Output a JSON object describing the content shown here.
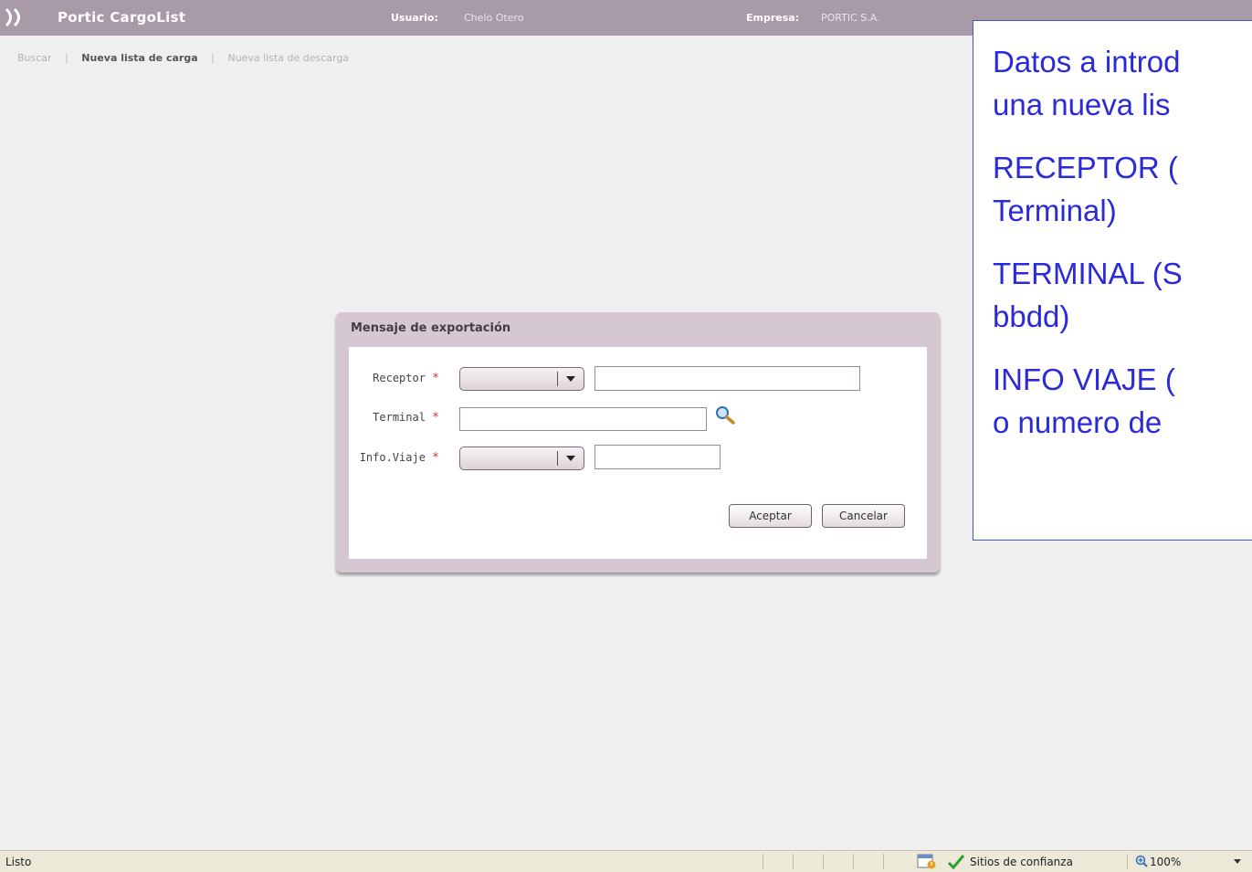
{
  "header": {
    "app_title": "Portic CargoList",
    "user_label": "Usuario:",
    "user_value": "Chelo Otero",
    "company_label": "Empresa:",
    "company_value": "PORTIC S.A."
  },
  "nav": {
    "items": [
      {
        "label": "Buscar",
        "active": false
      },
      {
        "label": "Nueva lista de carga",
        "active": true
      },
      {
        "label": "Nueva lista de descarga",
        "active": false
      }
    ],
    "separator": "|"
  },
  "dialog": {
    "title": "Mensaje de exportación",
    "fields": {
      "receptor": {
        "label": "Receptor",
        "required_mark": "*",
        "select_value": "",
        "text_value": ""
      },
      "terminal": {
        "label": "Terminal",
        "required_mark": "*",
        "text_value": ""
      },
      "info_viaje": {
        "label": "Info.Viaje",
        "required_mark": "*",
        "select_value": "",
        "text_value": ""
      }
    },
    "buttons": {
      "accept": "Aceptar",
      "cancel": "Cancelar"
    }
  },
  "callout": {
    "lines": [
      "Datos a introd",
      "una nueva lis",
      "RECEPTOR (",
      "Terminal)",
      "TERMINAL (S",
      "bbdd)",
      "INFO VIAJE (",
      "o numero de"
    ]
  },
  "statusbar": {
    "status": "Listo",
    "zone": "Sitios de confianza",
    "zoom": "100%"
  },
  "colors": {
    "header_bg": "#a89aa6",
    "dialog_frame": "#d6c8d3",
    "required": "#d83030",
    "callout_text": "#2a2ad8",
    "callout_border": "#3f55d8",
    "trusted_check": "#2e9e2e"
  },
  "icons": {
    "logo": "portic-logo-icon",
    "terminal_lookup": "magnifier-icon",
    "status_security": "security-warning-icon",
    "status_trusted": "checkmark-icon",
    "zoom": "zoom-icon",
    "zoom_menu": "dropdown-arrow-icon"
  }
}
